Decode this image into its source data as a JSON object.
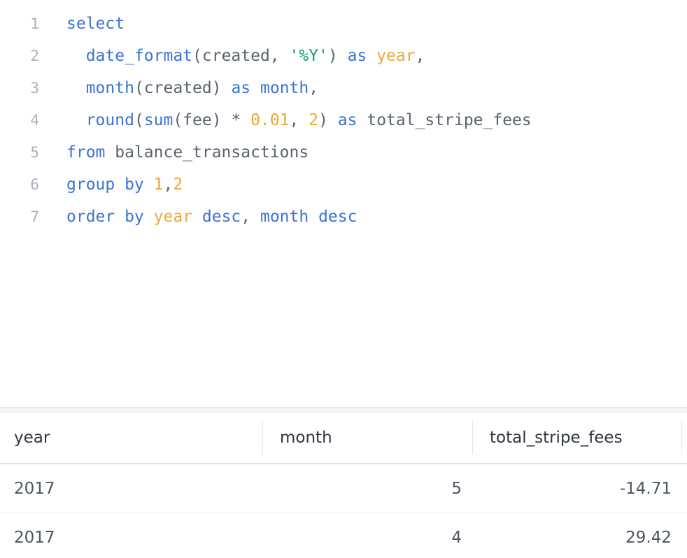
{
  "editor": {
    "lines": [
      {
        "number": "1",
        "tokens": [
          {
            "text": "select",
            "type": "kw"
          }
        ]
      },
      {
        "number": "2",
        "tokens": [
          {
            "text": "  ",
            "type": "plain"
          },
          {
            "text": "date_format",
            "type": "fn"
          },
          {
            "text": "(created, ",
            "type": "plain"
          },
          {
            "text": "'%Y'",
            "type": "str"
          },
          {
            "text": ") ",
            "type": "plain"
          },
          {
            "text": "as",
            "type": "kw"
          },
          {
            "text": " ",
            "type": "plain"
          },
          {
            "text": "year",
            "type": "id"
          },
          {
            "text": ",",
            "type": "plain"
          }
        ]
      },
      {
        "number": "3",
        "tokens": [
          {
            "text": "  ",
            "type": "plain"
          },
          {
            "text": "month",
            "type": "fn"
          },
          {
            "text": "(created) ",
            "type": "plain"
          },
          {
            "text": "as",
            "type": "kw"
          },
          {
            "text": " ",
            "type": "plain"
          },
          {
            "text": "month",
            "type": "fn"
          },
          {
            "text": ",",
            "type": "plain"
          }
        ]
      },
      {
        "number": "4",
        "tokens": [
          {
            "text": "  ",
            "type": "plain"
          },
          {
            "text": "round",
            "type": "fn"
          },
          {
            "text": "(",
            "type": "plain"
          },
          {
            "text": "sum",
            "type": "fn"
          },
          {
            "text": "(fee) * ",
            "type": "plain"
          },
          {
            "text": "0.01",
            "type": "num"
          },
          {
            "text": ", ",
            "type": "plain"
          },
          {
            "text": "2",
            "type": "num"
          },
          {
            "text": ") ",
            "type": "plain"
          },
          {
            "text": "as",
            "type": "kw"
          },
          {
            "text": " total_stripe_fees",
            "type": "plain"
          }
        ]
      },
      {
        "number": "5",
        "tokens": [
          {
            "text": "from",
            "type": "kw"
          },
          {
            "text": " balance_transactions",
            "type": "plain"
          }
        ]
      },
      {
        "number": "6",
        "tokens": [
          {
            "text": "group by",
            "type": "kw"
          },
          {
            "text": " ",
            "type": "plain"
          },
          {
            "text": "1",
            "type": "num"
          },
          {
            "text": ",",
            "type": "plain"
          },
          {
            "text": "2",
            "type": "num"
          }
        ]
      },
      {
        "number": "7",
        "tokens": [
          {
            "text": "order by",
            "type": "kw"
          },
          {
            "text": " ",
            "type": "plain"
          },
          {
            "text": "year",
            "type": "id"
          },
          {
            "text": " ",
            "type": "plain"
          },
          {
            "text": "desc",
            "type": "kw"
          },
          {
            "text": ", ",
            "type": "plain"
          },
          {
            "text": "month desc",
            "type": "kw"
          }
        ]
      }
    ]
  },
  "results": {
    "columns": [
      {
        "label": "year"
      },
      {
        "label": "month"
      },
      {
        "label": "total_stripe_fees"
      }
    ],
    "rows": [
      [
        "2017",
        "5",
        "-14.71"
      ],
      [
        "2017",
        "4",
        "29.42"
      ]
    ]
  },
  "colors": {
    "keyword": "#3b73d6",
    "string": "#15a07a",
    "number": "#e8a93a",
    "plain": "#5a6270",
    "line_number": "#a9b1bc"
  }
}
